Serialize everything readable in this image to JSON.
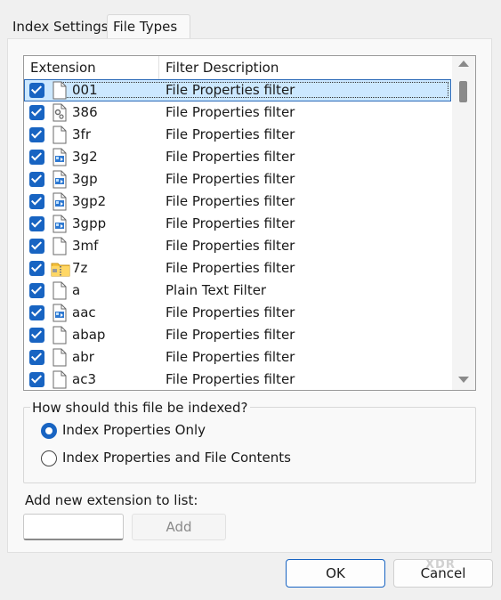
{
  "tabs": [
    "Index Settings",
    "File Types"
  ],
  "list": {
    "headers": {
      "extension": "Extension",
      "description": "Filter Description"
    },
    "rows": [
      {
        "ext": "001",
        "desc": "File Properties filter",
        "checked": true,
        "icon": "blank-file-icon",
        "selected": true
      },
      {
        "ext": "386",
        "desc": "File Properties filter",
        "checked": true,
        "icon": "system-file-icon"
      },
      {
        "ext": "3fr",
        "desc": "File Properties filter",
        "checked": true,
        "icon": "blank-file-icon"
      },
      {
        "ext": "3g2",
        "desc": "File Properties filter",
        "checked": true,
        "icon": "media-file-icon"
      },
      {
        "ext": "3gp",
        "desc": "File Properties filter",
        "checked": true,
        "icon": "media-file-icon"
      },
      {
        "ext": "3gp2",
        "desc": "File Properties filter",
        "checked": true,
        "icon": "media-file-icon"
      },
      {
        "ext": "3gpp",
        "desc": "File Properties filter",
        "checked": true,
        "icon": "media-file-icon"
      },
      {
        "ext": "3mf",
        "desc": "File Properties filter",
        "checked": true,
        "icon": "blank-file-icon"
      },
      {
        "ext": "7z",
        "desc": "File Properties filter",
        "checked": true,
        "icon": "zip-folder-icon"
      },
      {
        "ext": "a",
        "desc": "Plain Text Filter",
        "checked": true,
        "icon": "blank-file-icon"
      },
      {
        "ext": "aac",
        "desc": "File Properties filter",
        "checked": true,
        "icon": "media-file-icon"
      },
      {
        "ext": "abap",
        "desc": "File Properties filter",
        "checked": true,
        "icon": "blank-file-icon"
      },
      {
        "ext": "abr",
        "desc": "File Properties filter",
        "checked": true,
        "icon": "blank-file-icon"
      },
      {
        "ext": "ac3",
        "desc": "File Properties filter",
        "checked": true,
        "icon": "blank-file-icon"
      }
    ]
  },
  "index_group": {
    "title": "How should this file be indexed?",
    "options": [
      {
        "label": "Index Properties Only",
        "selected": true
      },
      {
        "label": "Index Properties and File Contents",
        "selected": false
      }
    ]
  },
  "add_extension": {
    "label": "Add new extension to list:",
    "value": "",
    "button_label": "Add"
  },
  "buttons": {
    "ok": "OK",
    "cancel": "Cancel"
  },
  "watermark": "XDA",
  "colors": {
    "accent": "#1864c2",
    "selection": "#cce8ff"
  }
}
